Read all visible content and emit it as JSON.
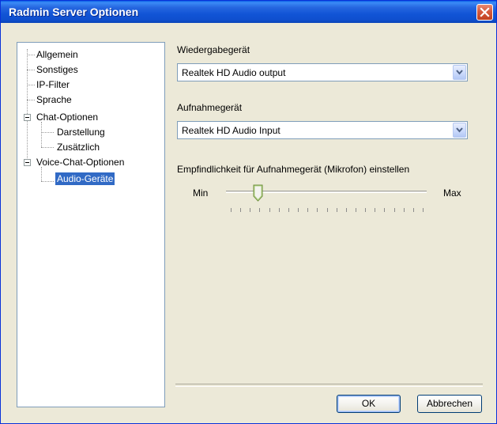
{
  "window": {
    "title": "Radmin Server Optionen"
  },
  "tree": {
    "items": [
      {
        "label": "Allgemein"
      },
      {
        "label": "Sonstiges"
      },
      {
        "label": "IP-Filter"
      },
      {
        "label": "Sprache"
      },
      {
        "label": "Chat-Optionen"
      },
      {
        "label": "Darstellung"
      },
      {
        "label": "Zusätzlich"
      },
      {
        "label": "Voice-Chat-Optionen"
      },
      {
        "label": "Audio-Geräte"
      }
    ],
    "selected": "Audio-Geräte"
  },
  "playback": {
    "label": "Wiedergabegerät",
    "value": "Realtek HD Audio output"
  },
  "recording": {
    "label": "Aufnahmegerät",
    "value": "Realtek HD Audio Input"
  },
  "sensitivity": {
    "label": "Empfindlichkeit für Aufnahmegerät (Mikrofon) einstellen",
    "min_label": "Min",
    "max_label": "Max",
    "level": 0.14
  },
  "buttons": {
    "ok": "OK",
    "cancel": "Abbrechen"
  }
}
